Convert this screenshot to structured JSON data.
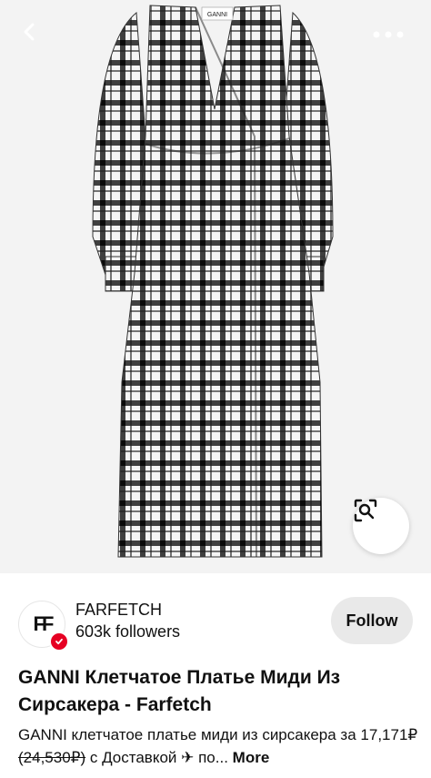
{
  "hero": {
    "brand_label_on_garment": "GANNI",
    "pattern_colors": {
      "dark": "#1e1e1e",
      "light": "#f5f5f5"
    }
  },
  "nav": {
    "back_icon": "chevron-left-icon",
    "more_icon": "ellipsis-icon",
    "lens_icon": "visual-search-icon"
  },
  "creator": {
    "name": "FARFETCH",
    "followers": "603k followers",
    "avatar_text": "FF",
    "verified_color": "#e60023",
    "follow_label": "Follow"
  },
  "pin": {
    "title": "GANNI Клетчатое Платье Миди Из Сирсакера - Farfetch",
    "desc_prefix": "GANNI клетчатое платье миди из сирсакера за 17,171₽ ",
    "desc_strike": "(24,530₽)",
    "desc_suffix": " с Доставкой ✈ по...",
    "more_label": "More"
  }
}
